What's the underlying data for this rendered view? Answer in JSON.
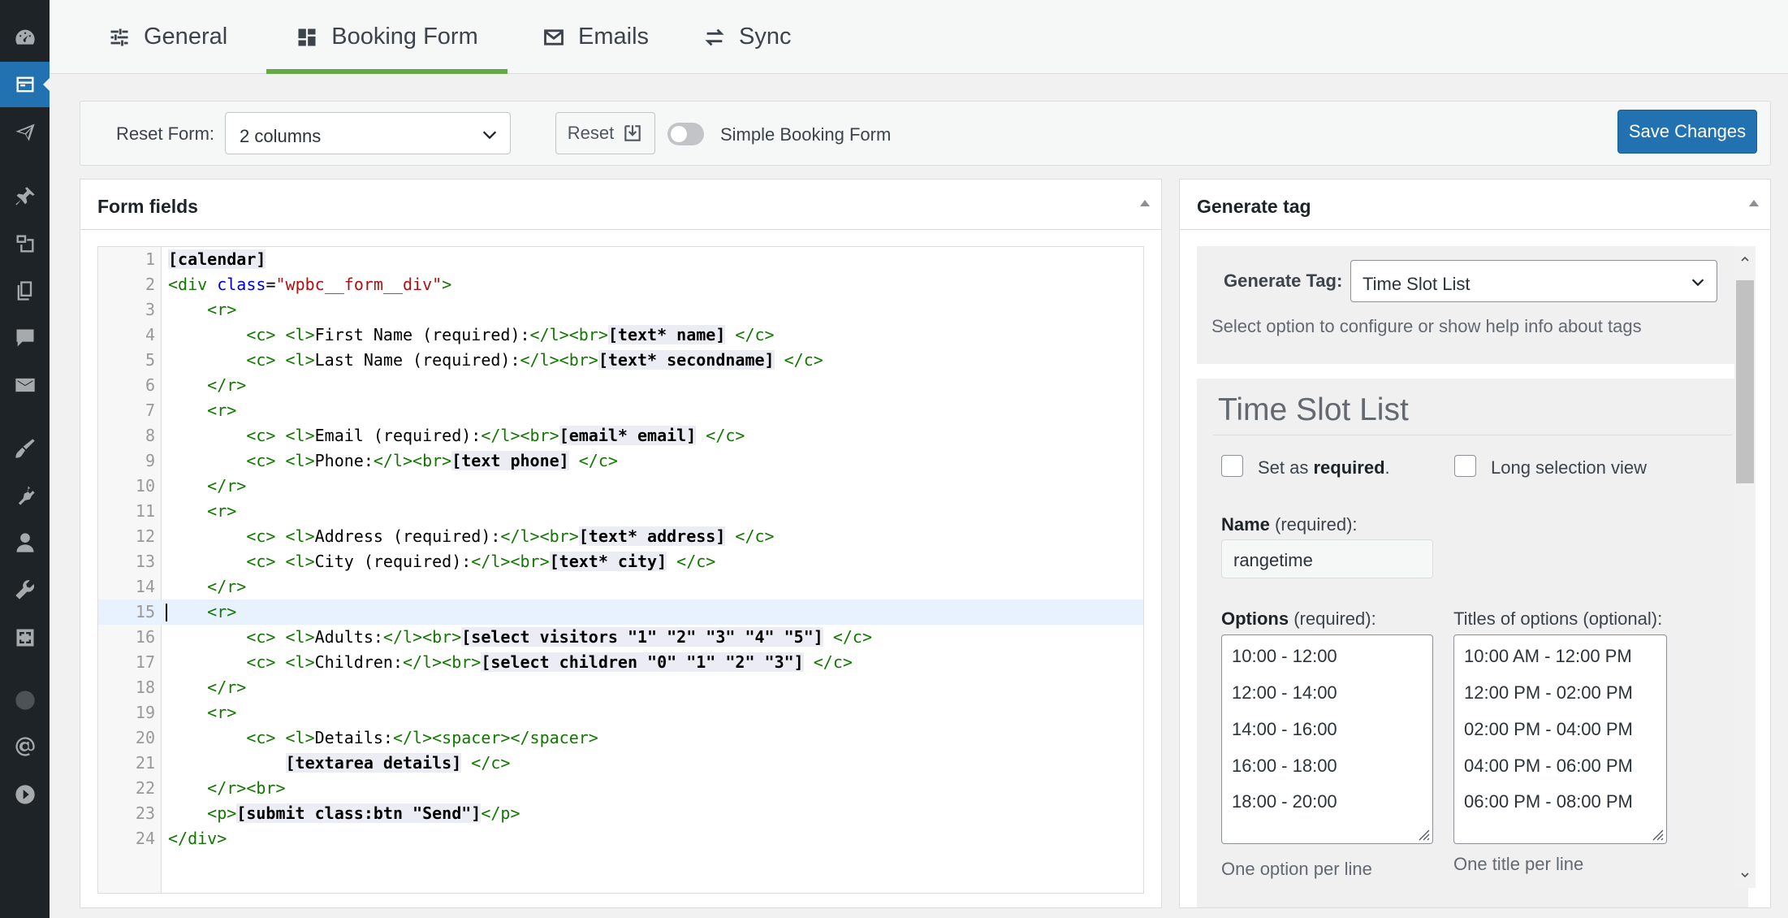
{
  "tabs": [
    {
      "label": "General",
      "icon": "sliders-icon"
    },
    {
      "label": "Booking Form",
      "icon": "dashboard-icon"
    },
    {
      "label": "Emails",
      "icon": "envelope-icon"
    },
    {
      "label": "Sync",
      "icon": "sync-arrows-icon"
    }
  ],
  "toolbar": {
    "reset_form_label": "Reset Form:",
    "reset_form_value": "2 columns",
    "reset_button_label": "Reset",
    "simple_toggle_label": "Simple Booking Form",
    "simple_toggle_on": false,
    "save_label": "Save Changes"
  },
  "form_panel": {
    "title": "Form fields",
    "lines": [
      "1",
      "2",
      "3",
      "4",
      "5",
      "6",
      "7",
      "8",
      "9",
      "10",
      "11",
      "12",
      "13",
      "14",
      "15",
      "16",
      "17",
      "18",
      "19",
      "20",
      "21",
      "22",
      "23",
      "24"
    ],
    "highlighted_line": "15"
  },
  "code": {
    "l1": {
      "k": "[calendar]"
    },
    "l2": {
      "open": "<div",
      "attr": "class",
      "eq": "=",
      "val": "\"wpbc__form__div\"",
      "close": ">"
    },
    "l3": {
      "t": "<r>"
    },
    "l4": {
      "c": "<c>",
      "l": "<l>",
      "text": "First Name (required):",
      "le": "</l>",
      "br": "<br>",
      "k": "[text* name]",
      "ce": "</c>"
    },
    "l5": {
      "c": "<c>",
      "l": "<l>",
      "text": "Last Name (required):",
      "le": "</l>",
      "br": "<br>",
      "k": "[text* secondname]",
      "ce": "</c>"
    },
    "l6": {
      "t": "</r>"
    },
    "l7": {
      "t": "<r>"
    },
    "l8": {
      "c": "<c>",
      "l": "<l>",
      "text": "Email (required):",
      "le": "</l>",
      "br": "<br>",
      "k": "[email* email]",
      "ce": "</c>"
    },
    "l9": {
      "c": "<c>",
      "l": "<l>",
      "text": "Phone:",
      "le": "</l>",
      "br": "<br>",
      "k": "[text phone]",
      "ce": "</c>"
    },
    "l10": {
      "t": "</r>"
    },
    "l11": {
      "t": "<r>"
    },
    "l12": {
      "c": "<c>",
      "l": "<l>",
      "text": "Address (required):",
      "le": "</l>",
      "br": "<br>",
      "k": "[text* address]",
      "ce": "</c>"
    },
    "l13": {
      "c": "<c>",
      "l": "<l>",
      "text": "City (required):",
      "le": "</l>",
      "br": "<br>",
      "k": "[text* city]",
      "ce": "</c>"
    },
    "l14": {
      "t": "</r>"
    },
    "l15": {
      "t": "<r>"
    },
    "l16": {
      "c": "<c>",
      "l": "<l>",
      "text": "Adults:",
      "le": "</l>",
      "br": "<br>",
      "k": "[select visitors \"1\" \"2\" \"3\" \"4\" \"5\"]",
      "ce": "</c>"
    },
    "l17": {
      "c": "<c>",
      "l": "<l>",
      "text": "Children:",
      "le": "</l>",
      "br": "<br>",
      "k": "[select children \"0\" \"1\" \"2\" \"3\"]",
      "ce": "</c>"
    },
    "l18": {
      "t": "</r>"
    },
    "l19": {
      "t": "<r>"
    },
    "l20": {
      "c": "<c>",
      "l": "<l>",
      "text": "Details:",
      "le": "</l>",
      "sp": "<spacer></spacer>"
    },
    "l21": {
      "k": "[textarea details]",
      "ce": "</c>"
    },
    "l22": {
      "t": "</r><br>"
    },
    "l23": {
      "p": "<p>",
      "k": "[submit class:btn \"Send\"]",
      "pe": "</p>"
    },
    "l24": {
      "t": "</div>"
    }
  },
  "generate_panel": {
    "title": "Generate tag",
    "generate_label": "Generate Tag:",
    "generate_value": "Time Slot List",
    "help_text": "Select option to configure or show help info about tags",
    "config_title": "Time Slot List",
    "required_checkbox": {
      "label_pre": "Set as ",
      "label_bold": "required",
      "label_post": ".",
      "checked": false
    },
    "long_view_checkbox": {
      "label": "Long selection view",
      "checked": false
    },
    "name_label_bold": "Name",
    "name_label_rest": " (required):",
    "name_value": "rangetime",
    "options_label_bold": "Options",
    "options_label_rest": " (required):",
    "options": [
      "10:00 - 12:00",
      "12:00 - 14:00",
      "14:00 - 16:00",
      "16:00 - 18:00",
      "18:00 - 20:00"
    ],
    "titles_label": "Titles of options (optional):",
    "titles": [
      "10:00 AM - 12:00 PM",
      "12:00 PM - 02:00 PM",
      "02:00 PM - 04:00 PM",
      "04:00 PM - 06:00 PM",
      "06:00 PM - 08:00 PM"
    ],
    "options_hint": "One option per line",
    "titles_hint": "One title per line"
  },
  "sidebar": {
    "icons": [
      "dashboard-icon",
      "booking-calendar-icon",
      "paper-plane-icon",
      "pin-icon",
      "media-icon",
      "pages-icon",
      "comments-icon",
      "mail-icon",
      "appearance-icon",
      "plugins-icon",
      "users-icon",
      "tools-icon",
      "settings-icon",
      "globe-icon",
      "at-sign-icon",
      "play-icon"
    ],
    "active": "booking-calendar-icon"
  },
  "colors": {
    "sidebar_bg": "#1d2327",
    "active_tab_underline": "#65a946",
    "primary_button": "#2271b1",
    "code_tag": "#117700",
    "code_attr": "#0000cc",
    "code_string": "#aa1111"
  }
}
